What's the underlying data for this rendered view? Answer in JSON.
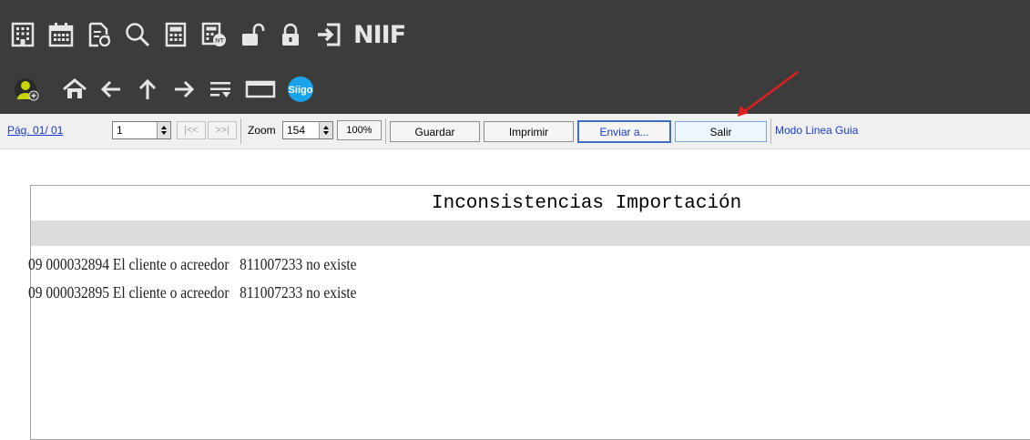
{
  "top_toolbar": {
    "row1_icons": [
      "building-icon",
      "calendar-icon",
      "document-refresh-icon",
      "search-icon",
      "calculator-icon",
      "calculator-ivt-icon",
      "unlock-icon",
      "lock-icon",
      "exit-icon"
    ],
    "niif_label": "NIIF",
    "row2_icons": [
      "user-add-icon",
      "home-icon",
      "arrow-left-icon",
      "arrow-up-icon",
      "arrow-right-icon",
      "filter-list-icon",
      "window-icon",
      "siigo-logo-icon"
    ],
    "siigo_logo_text": "Siigo"
  },
  "report_toolbar": {
    "page_label": "Pág. 01/ 01",
    "page_input": "1",
    "first_label": "|<<",
    "last_label": ">>|",
    "zoom_label": "Zoom",
    "zoom_value": "154",
    "zoom_100_label": "100%",
    "guardar_label": "Guardar",
    "imprimir_label": "Imprimir",
    "enviar_label": "Enviar a...",
    "salir_label": "Salir",
    "mode_label": "Modo Linea Guia"
  },
  "colors": {
    "toolbar_bg": "#3c3c3c",
    "accent_blue": "#1a3ad0",
    "arrow_red": "#e02020"
  },
  "report": {
    "title": "Inconsistencias Importación",
    "lines": [
      "09 000032894 El cliente o acreedor   811007233 no existe",
      "09 000032895 El cliente o acreedor   811007233 no existe"
    ]
  }
}
